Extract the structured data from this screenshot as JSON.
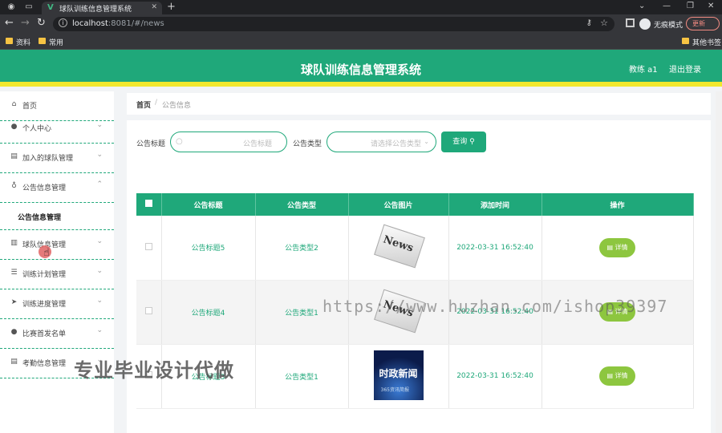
{
  "browser": {
    "tab_title": "球队训练信息管理系统",
    "url_host": "localhost",
    "url_path": ":8081/#/news",
    "incognito_label": "无痕模式",
    "update_label": "更新",
    "bookmarks": [
      "资料",
      "常用"
    ],
    "other_bookmarks": "其他书签"
  },
  "header": {
    "title": "球队训练信息管理系统",
    "user": "教练 a1",
    "logout": "退出登录"
  },
  "sidebar": {
    "items": [
      {
        "label": "首页",
        "icon": "home-icon"
      },
      {
        "label": "个人中心",
        "icon": "user-icon"
      },
      {
        "label": "加入的球队管理",
        "icon": "clipboard-icon"
      },
      {
        "label": "公告信息管理",
        "icon": "mic-icon"
      },
      {
        "label": "球队信息管理",
        "icon": "chart-icon"
      },
      {
        "label": "训练计划管理",
        "icon": "sliders-icon"
      },
      {
        "label": "训练进度管理",
        "icon": "send-icon"
      },
      {
        "label": "比赛首发名单",
        "icon": "user-icon"
      },
      {
        "label": "考勤信息管理",
        "icon": "clipboard-icon"
      }
    ],
    "submenu": "公告信息管理"
  },
  "breadcrumb": {
    "home": "首页",
    "sep": "/",
    "current": "公告信息"
  },
  "search": {
    "title_label": "公告标题",
    "title_placeholder": "公告标题",
    "type_label": "公告类型",
    "type_placeholder": "请选择公告类型",
    "button": "查询"
  },
  "table": {
    "headers": [
      "公告标题",
      "公告类型",
      "公告图片",
      "添加时间",
      "操作"
    ],
    "rows": [
      {
        "title": "公告标题5",
        "type": "公告类型2",
        "image": "news-paper",
        "time": "2022-03-31 16:52:40",
        "action": "详情"
      },
      {
        "title": "公告标题4",
        "type": "公告类型1",
        "image": "news-paper",
        "time": "2022-03-31 16:52:40",
        "action": "详情"
      },
      {
        "title": "公告标题3",
        "type": "公告类型1",
        "image": "tv-news",
        "time": "2022-03-31 16:52:40",
        "action": "详情"
      }
    ],
    "image_text": {
      "paper": "News",
      "tv_main": "时政新闻",
      "tv_sub": "365资讯简报"
    }
  },
  "watermarks": {
    "url": "https://www.huzhan.com/ishop39397",
    "cn": "专业毕业设计代做"
  },
  "colors": {
    "primary": "#1fa87a",
    "accent_bar": "#f2e82d",
    "detail_btn": "#8dc63f"
  }
}
